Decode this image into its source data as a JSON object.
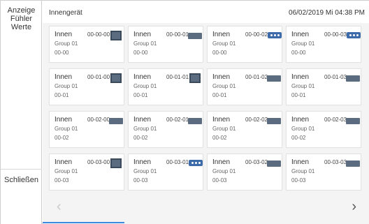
{
  "sidebar": {
    "display_label_line1": "Anzeige",
    "display_label_line2": "Fühler",
    "display_label_line3": "Werte",
    "close_label": "Schließen"
  },
  "header": {
    "title": "Innengerät",
    "datetime": "06/02/2019 Mi 04:38 PM"
  },
  "units": [
    {
      "name": "Innen",
      "address": "00-00-00",
      "group": "Group 01",
      "code": "00-00",
      "icon": "square-unit-icon"
    },
    {
      "name": "Innen",
      "address": "00-00-01",
      "group": "Group 01",
      "code": "00-00",
      "icon": "flat-unit-icon"
    },
    {
      "name": "Innen",
      "address": "00-00-02",
      "group": "Group 01",
      "code": "00-00",
      "icon": "wall-unit-icon"
    },
    {
      "name": "Innen",
      "address": "00-00-03",
      "group": "Group 01",
      "code": "00-00",
      "icon": "wall-unit-icon"
    },
    {
      "name": "Innen",
      "address": "00-01-00",
      "group": "Group 01",
      "code": "00-01",
      "icon": "square-unit-icon"
    },
    {
      "name": "Innen",
      "address": "00-01-01",
      "group": "Group 01",
      "code": "00-01",
      "icon": "square-unit-icon"
    },
    {
      "name": "Innen",
      "address": "00-01-02",
      "group": "Group 01",
      "code": "00-01",
      "icon": "flat-unit-icon"
    },
    {
      "name": "Innen",
      "address": "00-01-03",
      "group": "Group 01",
      "code": "00-01",
      "icon": "flat-unit-icon"
    },
    {
      "name": "Innen",
      "address": "00-02-00",
      "group": "Group 01",
      "code": "00-02",
      "icon": "flat-unit-icon"
    },
    {
      "name": "Innen",
      "address": "00-02-01",
      "group": "Group 01",
      "code": "00-02",
      "icon": "flat-unit-icon"
    },
    {
      "name": "Innen",
      "address": "00-02-02",
      "group": "Group 01",
      "code": "00-02",
      "icon": "flat-unit-icon"
    },
    {
      "name": "Innen",
      "address": "00-02-03",
      "group": "Group 01",
      "code": "00-02",
      "icon": "flat-unit-icon"
    },
    {
      "name": "Innen",
      "address": "00-03-00",
      "group": "Group 01",
      "code": "00-03",
      "icon": "square-unit-icon"
    },
    {
      "name": "Innen",
      "address": "00-03-01",
      "group": "Group 01",
      "code": "00-03",
      "icon": "wall-unit-icon"
    },
    {
      "name": "Innen",
      "address": "00-03-02",
      "group": "Group 01",
      "code": "00-03",
      "icon": "flat-unit-icon"
    },
    {
      "name": "Innen",
      "address": "00-03-03",
      "group": "Group 01",
      "code": "00-03",
      "icon": "flat-unit-icon"
    }
  ],
  "pagination": {
    "prev_glyph": "‹",
    "next_glyph": "›",
    "page_progress": 0.25
  },
  "colors": {
    "accent": "#3d8be0",
    "unit_icon": "#5b6c80",
    "wall_icon": "#3d6aa8"
  }
}
